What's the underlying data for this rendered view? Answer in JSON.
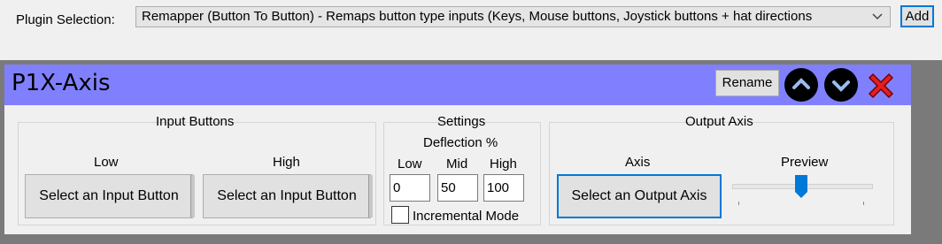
{
  "plugin": {
    "label": "Plugin Selection:",
    "selected": "Remapper (Button To Button)    - Remaps button type inputs (Keys, Mouse buttons, Joystick buttons + hat directions",
    "add_label": "Add"
  },
  "panel": {
    "title": "P1X-Axis",
    "rename_label": "Rename",
    "input_buttons": {
      "title": "Input Buttons",
      "low_label": "Low",
      "high_label": "High",
      "low_button": "Select an Input Button",
      "high_button": "Select an Input Button"
    },
    "settings": {
      "title": "Settings",
      "deflection_label": "Deflection %",
      "low_label": "Low",
      "mid_label": "Mid",
      "high_label": "High",
      "low_value": "0",
      "mid_value": "50",
      "high_value": "100",
      "incremental_label": "Incremental Mode",
      "incremental_checked": false
    },
    "output_axis": {
      "title": "Output Axis",
      "axis_label": "Axis",
      "preview_label": "Preview",
      "select_button": "Select an Output Axis",
      "preview_level": 0.5
    }
  },
  "colors": {
    "title_bar": "#8080ff",
    "accent": "#0078d7",
    "close": "#e02020"
  }
}
